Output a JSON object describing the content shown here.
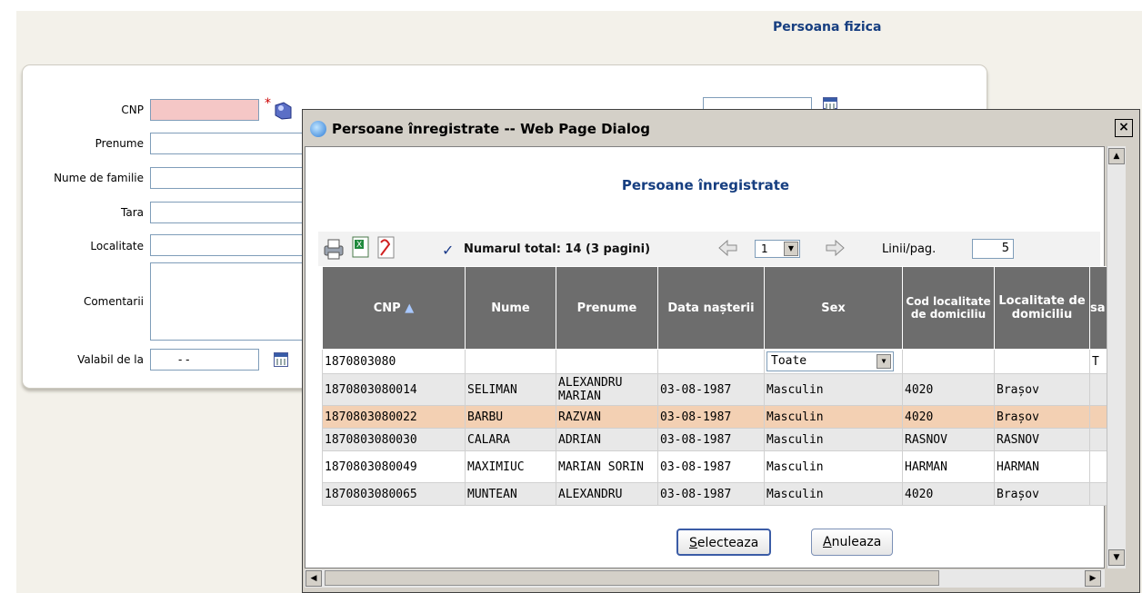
{
  "page": {
    "title": "Persoana fizica"
  },
  "form": {
    "cnp_label": "CNP",
    "cnp_value": "",
    "required_mark": "*",
    "prenume_label": "Prenume",
    "nume_familie_label": "Nume de familie",
    "tara_label": "Tara",
    "localitate_label": "Localitate",
    "comentarii_label": "Comentarii",
    "valabil_label": "Valabil de la",
    "valabil_value": "-   -"
  },
  "dialog": {
    "window_title": "Persoane înregistrate -- Web Page Dialog",
    "close_label": "×",
    "heading": "Persoane înregistrate",
    "toolbar": {
      "check_symbol": "✓",
      "total_text": "Numarul total: 14 (3 pagini)",
      "page_value": "1",
      "rows_label": "Linii/pag.",
      "rows_value": "5"
    },
    "table": {
      "columns": [
        "CNP",
        "Nume",
        "Prenume",
        "Data nașterii",
        "Sex",
        "Cod localitate de domiciliu",
        "Localitate de domiciliu",
        "sa"
      ],
      "sort_indicator": "▲",
      "filter": {
        "cnp": "1870803080",
        "sex": "Toate",
        "last": "T"
      },
      "rows": [
        [
          "1870803080014",
          "SELIMAN",
          "ALEXANDRU MARIAN",
          "03-08-1987",
          "Masculin",
          "4020",
          "Brașov",
          ""
        ],
        [
          "1870803080022",
          "BARBU",
          "RAZVAN",
          "03-08-1987",
          "Masculin",
          "4020",
          "Brașov",
          ""
        ],
        [
          "1870803080030",
          "CALARA",
          "ADRIAN",
          "03-08-1987",
          "Masculin",
          "RASNOV",
          "RASNOV",
          ""
        ],
        [
          "1870803080049",
          "MAXIMIUC",
          "MARIAN SORIN",
          "03-08-1987",
          "Masculin",
          "HARMAN",
          "HARMAN",
          ""
        ],
        [
          "1870803080065",
          "MUNTEAN",
          "ALEXANDRU",
          "03-08-1987",
          "Masculin",
          "4020",
          "Brașov",
          ""
        ]
      ]
    },
    "buttons": {
      "select_key": "S",
      "select_rest": "electeaza",
      "cancel_key": "A",
      "cancel_rest": "nuleaza"
    }
  },
  "colors": {
    "accent": "#163e80",
    "header_bg": "#6d6d6d",
    "selected_row": "#f3d0b3",
    "required_field": "#f5c7c6"
  },
  "icons": [
    "print-icon",
    "excel-icon",
    "pdf-icon",
    "check-icon",
    "prev-page-icon",
    "next-page-icon",
    "calendar-icon",
    "lookup-icon",
    "ie-icon"
  ]
}
